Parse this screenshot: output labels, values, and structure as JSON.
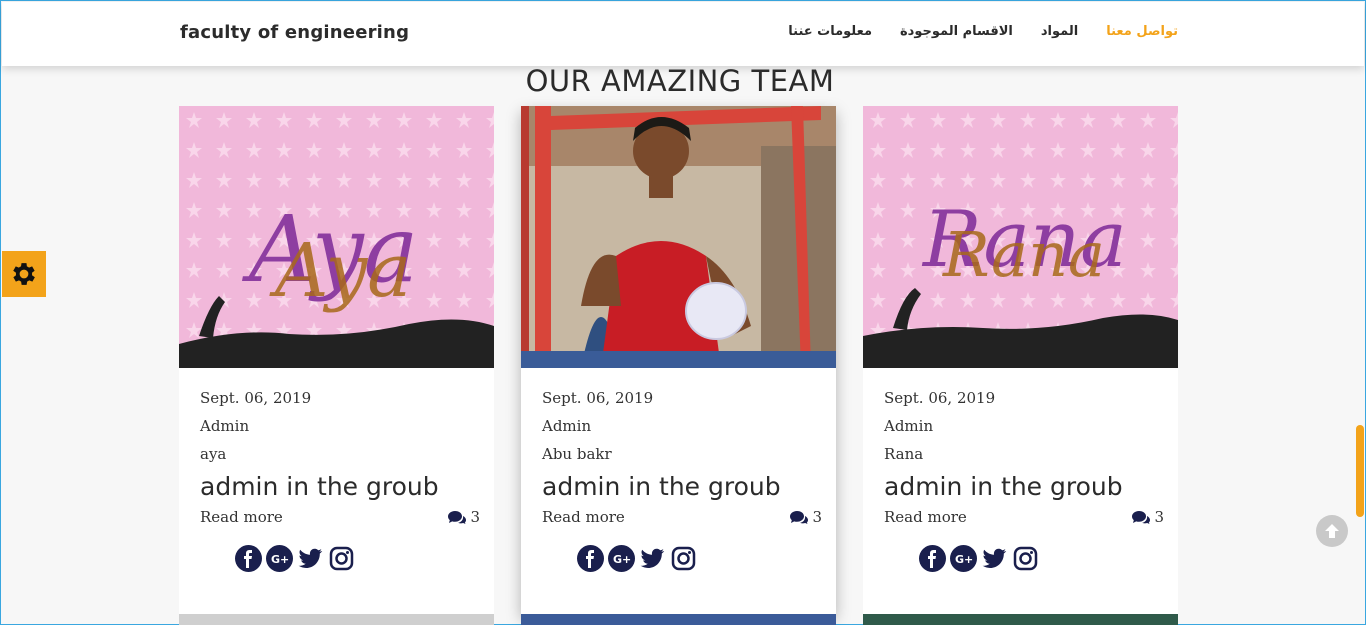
{
  "brand": "faculty of engineering",
  "nav": {
    "items": [
      {
        "label": "تواصل معنا",
        "active": true
      },
      {
        "label": "المواد",
        "active": false
      },
      {
        "label": "الاقسام الموجودة",
        "active": false
      },
      {
        "label": "معلومات عننا",
        "active": false
      }
    ]
  },
  "section_title": "OUR AMAZING TEAM",
  "cards": [
    {
      "image_text": "Aya",
      "date": "Sept. 06, 2019",
      "author": "Admin",
      "name": "aya",
      "headline": "admin in the groub",
      "read_more": "Read more",
      "comments": "3"
    },
    {
      "image_text": "",
      "date": "Sept. 06, 2019",
      "author": "Admin",
      "name": "Abu bakr",
      "headline": "admin in the groub",
      "read_more": "Read more",
      "comments": "3"
    },
    {
      "image_text": "Rana",
      "date": "Sept. 06, 2019",
      "author": "Admin",
      "name": "Rana",
      "headline": "admin in the groub",
      "read_more": "Read more",
      "comments": "3"
    }
  ],
  "icons": {
    "social": [
      "facebook-icon",
      "google-plus-icon",
      "twitter-icon",
      "instagram-icon"
    ],
    "gear": "gear-icon",
    "up": "arrow-up-icon",
    "comments": "comments-icon"
  },
  "colors": {
    "accent": "#f3a31a",
    "social": "#1a1f4d",
    "pink_bg": "#f1b8da"
  }
}
